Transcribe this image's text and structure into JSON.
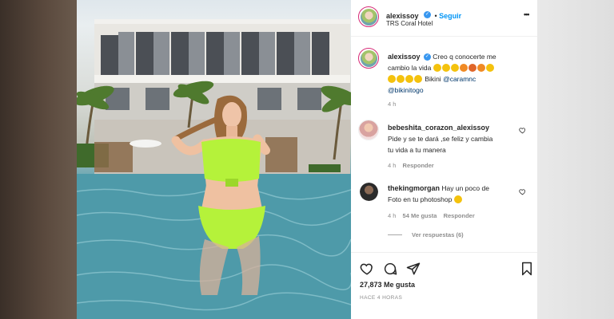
{
  "post": {
    "username": "alexissoy",
    "follow_label": "Seguir",
    "location": "TRS Coral Hotel",
    "more_menu": "•••"
  },
  "caption": {
    "username": "alexissoy",
    "text_line1": "Creo q conocerte me",
    "text_line2_pre": "cambio la vida",
    "text_line3_post": "Bikini",
    "mention1": "@caramnc",
    "mention2": "@bikinitogo",
    "time": "4 h",
    "emojis_line2": [
      "#f4c20d",
      "#f4c20d",
      "#f4c20d",
      "#f08a24",
      "#e0662a",
      "#f08a24",
      "#f4c20d"
    ],
    "emojis_line3": [
      "#f4c20d",
      "#f4c20d",
      "#f4c20d",
      "#f4c20d"
    ]
  },
  "comments": [
    {
      "username": "bebeshita_corazon_alexissoy",
      "line1": "Pide y se te dará ,se feliz y cambia",
      "line2": "tu vida a tu manera",
      "time": "4 h",
      "reply": "Responder"
    },
    {
      "username": "thekingmorgan",
      "line1_suffix": "Hay un poco de",
      "line2": "Foto en tu photoshop",
      "time": "4 h",
      "likes": "54 Me gusta",
      "reply": "Responder",
      "view_replies": "Ver respuestas (6)"
    }
  ],
  "footer": {
    "likes": "27,873 Me gusta",
    "posted_ago": "HACE 4 HORAS"
  },
  "colors": {
    "accent_blue": "#0095f6",
    "verified_blue": "#3897f0",
    "bikini_green": "#b5f23a"
  }
}
